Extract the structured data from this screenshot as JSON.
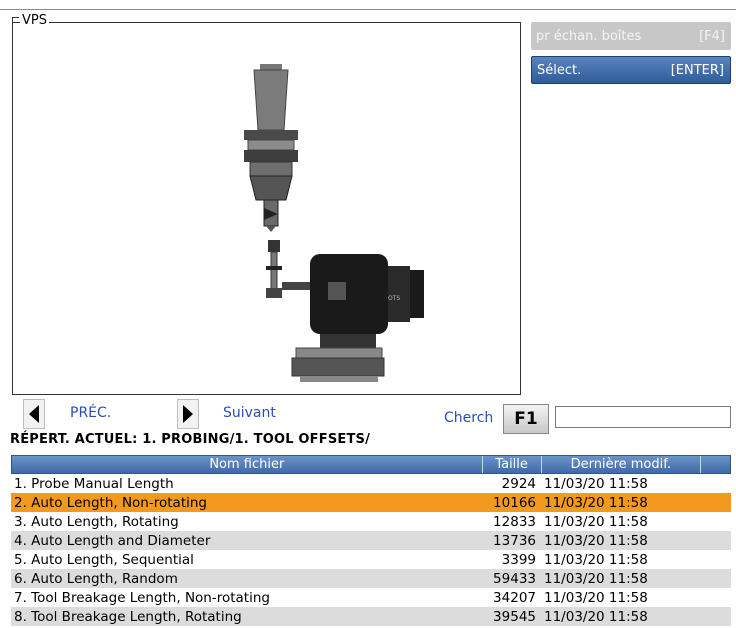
{
  "vps": {
    "title": "VPS"
  },
  "menu": {
    "sample_boxes": {
      "label": "pr échan. boîtes",
      "key": "[F4]"
    },
    "select": {
      "label": "Sélect.",
      "key": "[ENTER]"
    }
  },
  "nav": {
    "prev_label": "PRÉC.",
    "next_label": "Suivant",
    "search_label": "Cherch",
    "search_key": "F1",
    "search_value": ""
  },
  "current_dir": "RÉPERT. ACTUEL: 1. PROBING/1. TOOL OFFSETS/",
  "table": {
    "headers": {
      "name": "Nom fichier",
      "size": "Taille",
      "modified": "Dernière modif."
    },
    "rows": [
      {
        "name": "1. Probe Manual Length",
        "size": "2924",
        "modified": "11/03/20 11:58"
      },
      {
        "name": "2. Auto Length, Non-rotating",
        "size": "10166",
        "modified": "11/03/20 11:58"
      },
      {
        "name": "3. Auto Length, Rotating",
        "size": "12833",
        "modified": "11/03/20 11:58"
      },
      {
        "name": "4. Auto Length and Diameter",
        "size": "13736",
        "modified": "11/03/20 11:58"
      },
      {
        "name": "5. Auto Length, Sequential",
        "size": "3399",
        "modified": "11/03/20 11:58"
      },
      {
        "name": "6. Auto Length, Random",
        "size": "59433",
        "modified": "11/03/20 11:58"
      },
      {
        "name": "7. Tool Breakage Length, Non-rotating",
        "size": "34207",
        "modified": "11/03/20 11:58"
      },
      {
        "name": "8. Tool Breakage Length, Rotating",
        "size": "39545",
        "modified": "11/03/20 11:58"
      }
    ],
    "selected_index": 1
  },
  "colors": {
    "header_blue": "#4f7bb8",
    "selected_row": "#f39a1e",
    "link_blue": "#2a4fb0"
  },
  "illustration": {
    "brand_text": "OTS"
  }
}
